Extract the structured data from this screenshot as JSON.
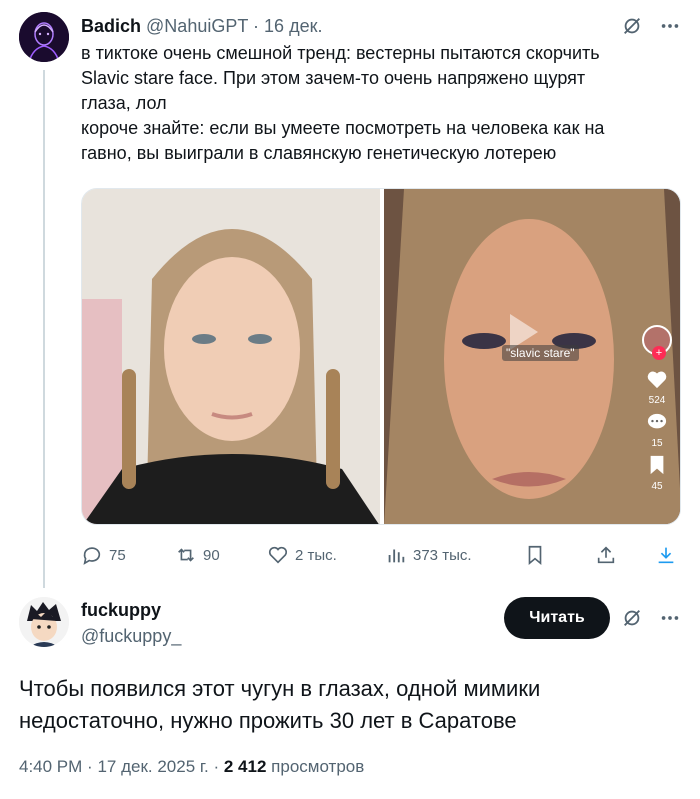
{
  "tweet1": {
    "author_name": "Badich",
    "handle": "@NahuiGPT",
    "separator": "·",
    "date": "16 дек.",
    "text_lines": [
      "в тиктоке очень смешной тренд: вестерны пытаются скорчить",
      "Slavic stare face. При этом зачем-то очень напряжено щурят",
      "глаза, лол",
      "короче знайте: если вы умеете посмотреть на человека как на",
      "гавно, вы выиграли в славянскую генетическую лотерею"
    ],
    "media": {
      "overlay_label": "\"slavic stare\"",
      "tiktok": {
        "likes": "524",
        "comments": "15",
        "saves": "45"
      }
    },
    "actions": {
      "replies": "75",
      "reposts": "90",
      "likes": "2 тыс.",
      "views": "373 тыс."
    }
  },
  "tweet2": {
    "author_name": "fuckuppy",
    "handle": "@fuckuppy_",
    "follow_label": "Читать",
    "text_lines": [
      "Чтобы появился этот чугун в глазах, одной мимики",
      "недостаточно, нужно прожить 30 лет в Саратове"
    ],
    "meta": {
      "time": "4:40 PM",
      "separator": "·",
      "date": "17 дек. 2025 г.",
      "views_count": "2 412",
      "views_label": "просмотров"
    }
  },
  "colors": {
    "text": "#0f1419",
    "secondary": "#536471",
    "thread_line": "#cfd9de",
    "button_bg": "#0f1419"
  },
  "icons": [
    "grok-icon",
    "more-icon",
    "reply-icon",
    "repost-icon",
    "like-icon",
    "views-icon",
    "bookmark-icon",
    "share-icon",
    "download-icon"
  ]
}
